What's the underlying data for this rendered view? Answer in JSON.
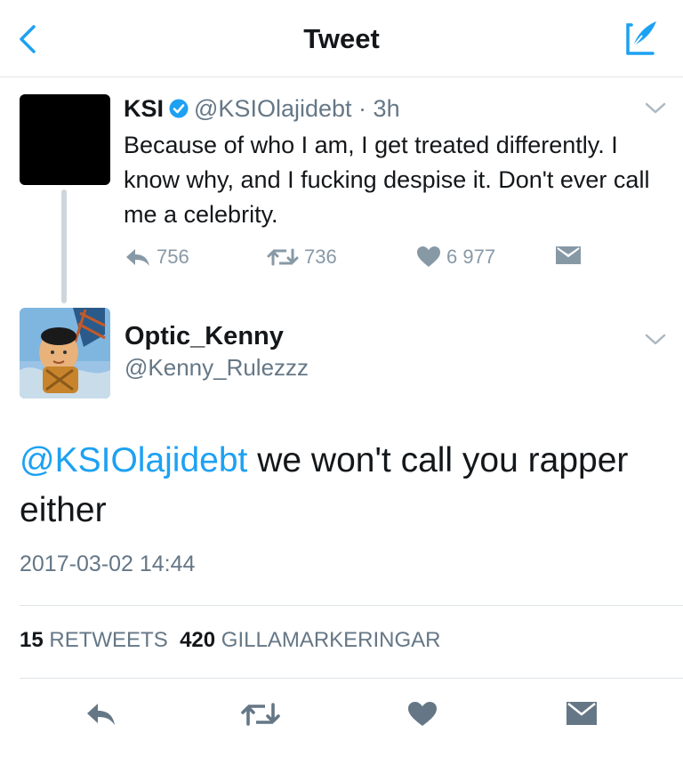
{
  "nav": {
    "title": "Tweet"
  },
  "original": {
    "name": "KSI",
    "handle": "@KSIOlajidebt",
    "separator": "·",
    "time": "3h",
    "text": "Because of who I am, I get treated differently. I know why, and I fucking despise it. Don't ever call me a celebrity.",
    "replies": "756",
    "retweets": "736",
    "likes": "6 977"
  },
  "reply": {
    "name": "Optic_Kenny",
    "handle": "@Kenny_Rulezzz",
    "mention": "@KSIOlajidebt",
    "text": " we won't call you rapper either",
    "timestamp": "2017-03-02 14:44",
    "retweet_count": "15",
    "retweet_label": "RETWEETS",
    "like_count": "420",
    "like_label": "GILLAMARKERINGAR"
  },
  "colors": {
    "accent": "#1da1f2",
    "muted": "#657786",
    "icon": "#8899a6",
    "dark_icon": "#657786"
  },
  "icons": [
    "back-icon",
    "compose-icon",
    "verified-icon",
    "chevron-down-icon",
    "reply-icon",
    "retweet-icon",
    "heart-icon",
    "dm-icon"
  ]
}
